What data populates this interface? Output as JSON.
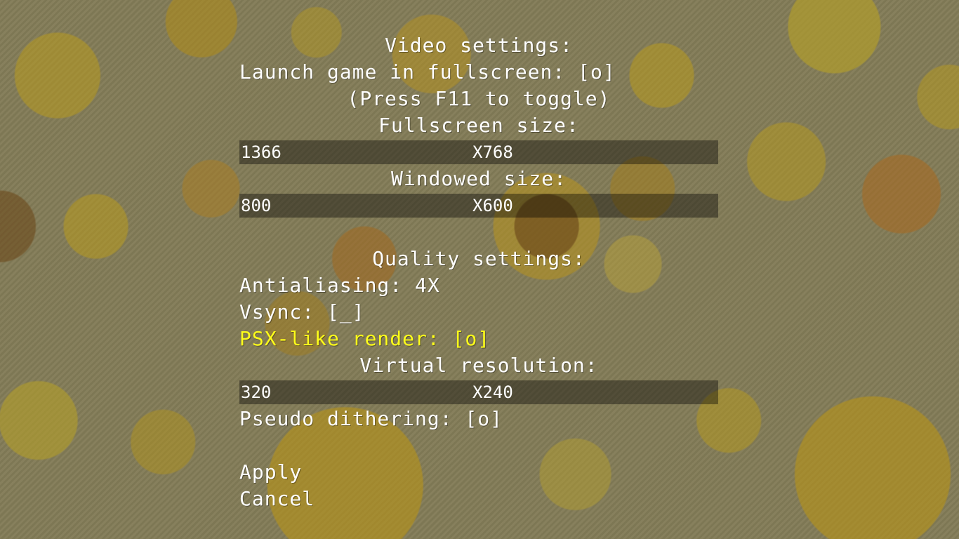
{
  "video": {
    "heading": "Video settings:",
    "fullscreen_option": "Launch game in fullscreen: [o]",
    "fullscreen_hint": "(Press F11 to toggle)",
    "fullscreen_size_label": "Fullscreen size:",
    "fullscreen_width": "1366",
    "fullscreen_height": "X768",
    "windowed_size_label": "Windowed size:",
    "windowed_width": "800",
    "windowed_height": "X600"
  },
  "quality": {
    "heading": "Quality settings:",
    "antialiasing": "Antialiasing: 4X",
    "vsync": "Vsync: [_]",
    "psx_render": "PSX-like render: [o]",
    "virtual_resolution_label": "Virtual resolution:",
    "virtual_width": "320",
    "virtual_height": "X240",
    "pseudo_dithering": "Pseudo dithering: [o]"
  },
  "actions": {
    "apply": "Apply",
    "cancel": "Cancel"
  },
  "colors": {
    "text": "#ffffff",
    "selected": "#ffff1a",
    "field_bg": "rgba(0,0,0,0.38)"
  }
}
